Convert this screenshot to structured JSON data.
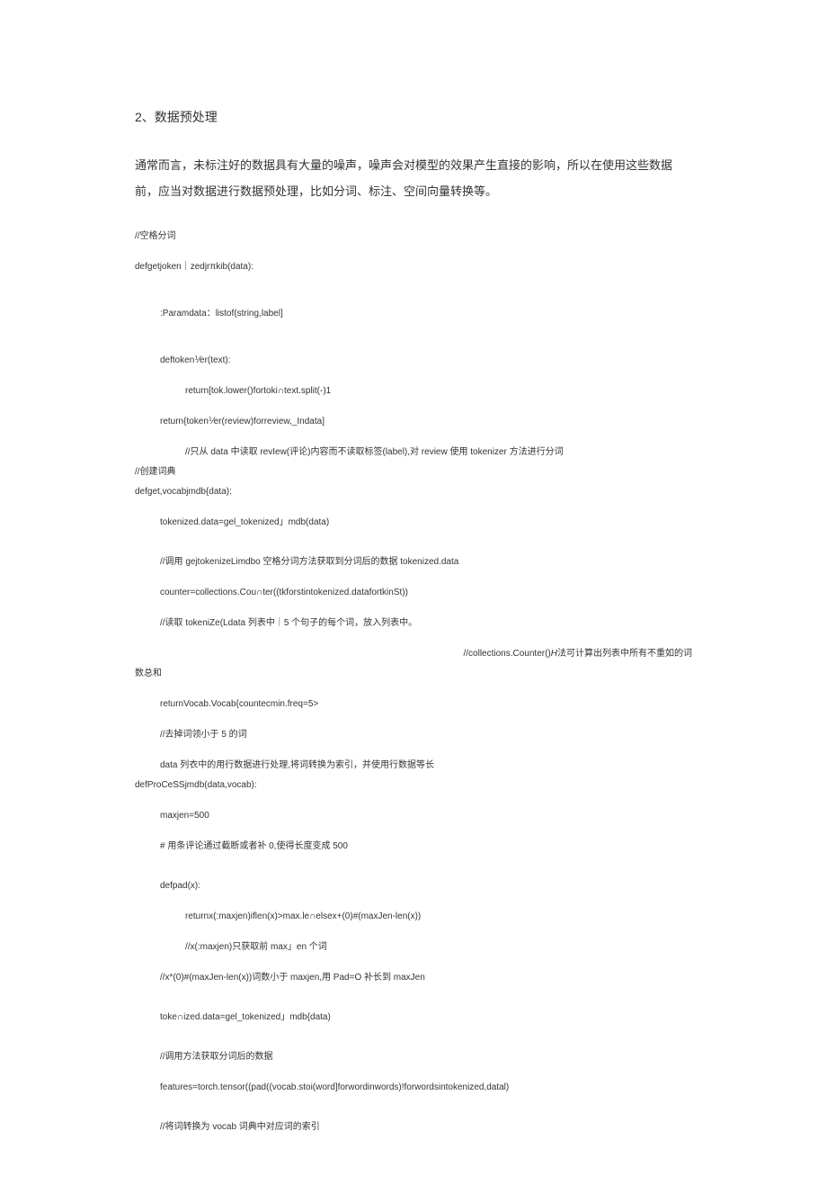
{
  "heading": "2、数据预处理",
  "intro": "通常而言，未标注好的数据具有大量的噪声，噪声会对模型的效果产生直接的影响，所以在使用这些数据前，应当对数据进行数据预处理，比如分词、标注、空间向量转换等。",
  "lines": {
    "c1": "//空格分词",
    "c2": "defgetjoken｜zedjrπkib(data):",
    "c3": ":Paramdata：listof(string,label]",
    "c4": "deftoken⅟er(text):",
    "c5": "return[tok.lower()fortoki∩text.split(-)1",
    "c6": "return{token⅟er(review)forreview,_Indata]",
    "c7": "//只从 data 中读取 revIew(评论)内容而不读取标签(label),对 review 使用 tokenizer 方法进行分词",
    "c8": "//创建词典",
    "c9": "defget,vocabjmdb{data):",
    "c10": "tokenized.data=gel_tokenized」mdb(data)",
    "c11": "//调用 gejtokenizeLimdbo 空格分词方法获取到分词后的数据 tokenized.data",
    "c12": "counter=collections.Cou∩ter((tkforstintokenized.datafortkinSt))",
    "c13": "//读取 tokeniZe(Ldata 列表中｜5 个句子的每个词，放入列表中。",
    "c14a": "//collections.Counter()",
    "c14b": "H",
    "c14c": "法可计算出列表中所有不重如的词",
    "c15": "数总和",
    "c16": "returnVocab.Vocab{countecmin.freq=5>",
    "c17": "//去掉词领小于 5 的词",
    "c18": "data 列衣中的用行数据进行处理,将词转换为索引，并使用行数据等长",
    "c19": "defProCeSSjmdb(data,vocab):",
    "c20": "maxjen=500",
    "c21": "# 用条评论通过截断或者补 0,使得长度变成 500",
    "c22": "defpad(x):",
    "c23": "returnx(:maxjen)iflen(x)>max.le∩elsex+(0)#(maxJen-len(x))",
    "c24": "//x(:maxjen)只获取前 max」en 个词",
    "c25": "//x*(0)#(maxJen-len(x))词数小于 maxjen,用 Pad=O 补长到 maxJen",
    "c26": "toke∩ized.data=gel_tokenized」mdb{data)",
    "c27": "//调用方法获取分词后的数据",
    "c28": "features=torch.tensor((pad((vocab.stoi(word]forwordinwords)!forwordsintokenized,datal)",
    "c29": "//将词转换为 vocab 词典中对应词的索引"
  }
}
